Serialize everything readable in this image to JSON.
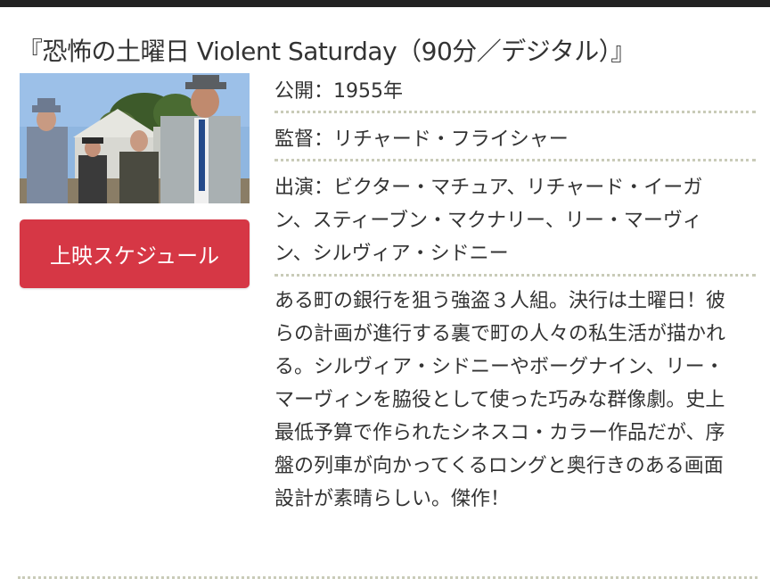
{
  "movie": {
    "title": "『恐怖の土曜日 Violent Saturday（90分／デジタル）』",
    "release": "公開：1955年",
    "director": "監督：リチャード・フライシャー",
    "cast": "出演：ビクター・マチュア、リチャード・イーガン、スティーブン・マクナリー、リー・マーヴィン、シルヴィア・シドニー",
    "description": "ある町の銀行を狙う強盗３人組。決行は土曜日！彼らの計画が進行する裏で町の人々の私生活が描かれる。シルヴィア・シドニーやボーグナイン、リー・マーヴィンを脇役として使った巧みな群像劇。史上最低予算で作られたシネスコ・カラー作品だが、序盤の列車が向かってくるロングと奥行きのある画面設計が素晴らしい。傑作！"
  },
  "actions": {
    "schedule_label": "上映スケジュール"
  },
  "colors": {
    "button_bg": "#d63745",
    "divider": "#c9cbb8",
    "top_bar": "#222222"
  }
}
